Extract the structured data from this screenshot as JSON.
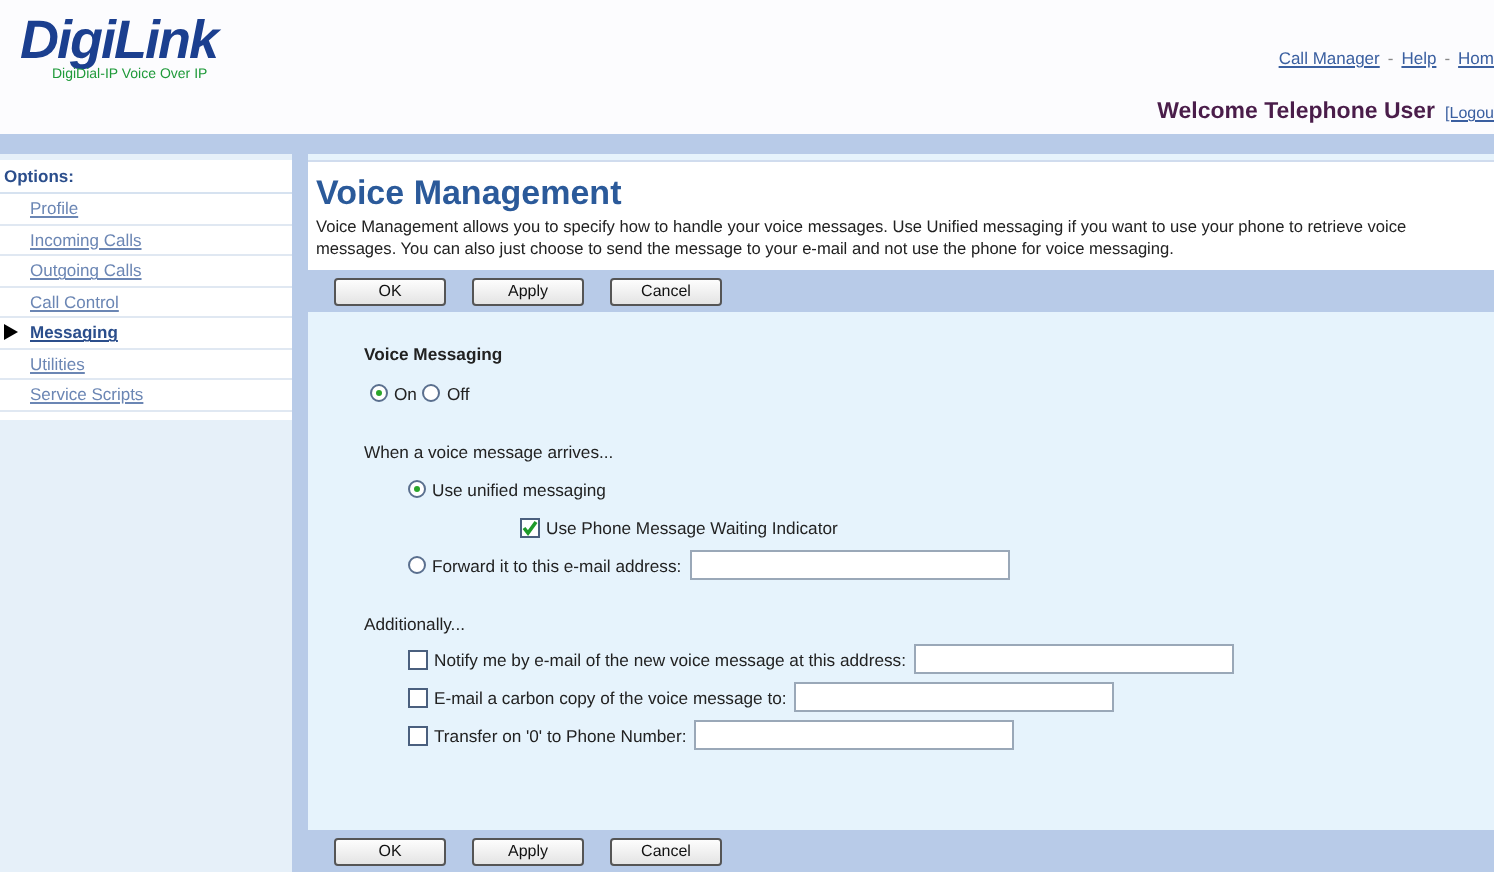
{
  "header": {
    "logo": "DigiLink",
    "tagline": "DigiDial-IP Voice Over IP",
    "nav_links": [
      {
        "label": "Call Manager"
      },
      {
        "label": "Help"
      },
      {
        "label": "Hom"
      }
    ],
    "separator": "-",
    "welcome": "Welcome Telephone User",
    "logout": "[Logou"
  },
  "sidebar": {
    "heading": "Options:",
    "items": [
      {
        "label": "Profile",
        "selected": false
      },
      {
        "label": "Incoming Calls",
        "selected": false
      },
      {
        "label": "Outgoing Calls",
        "selected": false
      },
      {
        "label": "Call Control",
        "selected": false
      },
      {
        "label": "Messaging",
        "selected": true
      },
      {
        "label": "Utilities",
        "selected": false
      },
      {
        "label": "Service Scripts",
        "selected": false
      }
    ]
  },
  "page": {
    "title": "Voice Management",
    "description": "Voice Management allows you to specify how to handle your voice messages. Use Unified messaging if you want to use your phone to retrieve voice messages. You can also just choose to send the message to your e-mail and not use the phone for voice messaging.",
    "top_buttons": [
      "OK",
      "Apply",
      "Cancel"
    ],
    "voice_messaging": {
      "label": "Voice Messaging",
      "options": [
        {
          "label": "On",
          "selected": true
        },
        {
          "label": "Off",
          "selected": false
        }
      ]
    },
    "arrival": {
      "label": "When a voice message arrives...",
      "options": [
        {
          "kind": "radio",
          "label": "Use unified messaging",
          "selected": true,
          "children": [
            {
              "label": "Use Phone Message Waiting Indicator",
              "checked": true
            }
          ]
        },
        {
          "kind": "radio_field",
          "label": "Forward it to this e-mail address:",
          "selected": false
        }
      ]
    },
    "additionally": {
      "label": "Additionally...",
      "options": [
        {
          "label": "Notify me by e-mail of the new voice message at this address:",
          "checked": false
        },
        {
          "label": "E-mail a carbon copy of the voice message to:",
          "checked": false
        },
        {
          "label": "Transfer on '0' to Phone Number:",
          "checked": false
        }
      ]
    },
    "bottom_buttons": [
      "OK",
      "Apply",
      "Cancel"
    ]
  }
}
